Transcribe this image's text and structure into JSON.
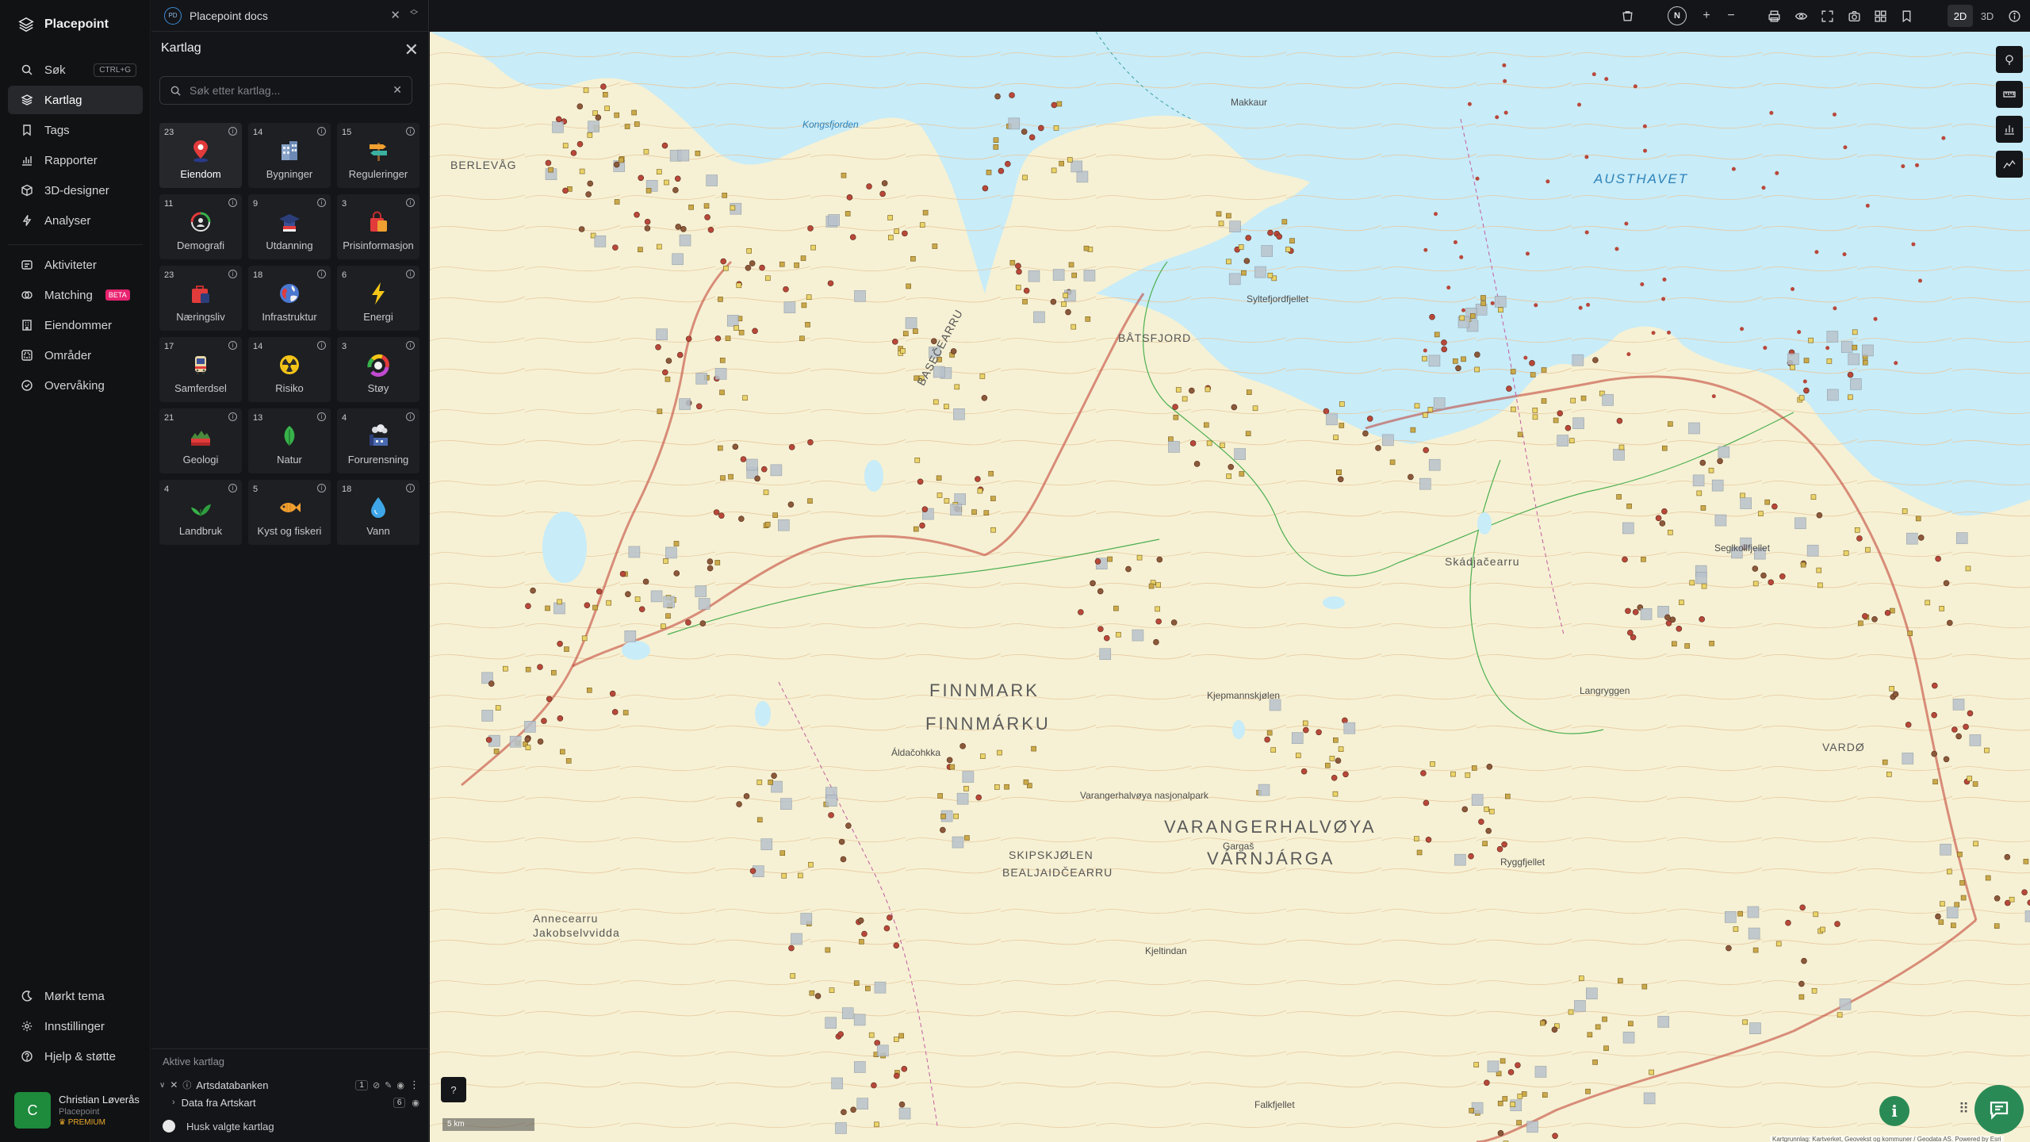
{
  "app": {
    "name": "Placepoint"
  },
  "nav": {
    "search": {
      "label": "Søk",
      "shortcut": "CTRL+G"
    },
    "items": [
      {
        "label": "Kartlag",
        "icon": "layers-icon",
        "active": true
      },
      {
        "label": "Tags",
        "icon": "bookmark-icon"
      },
      {
        "label": "Rapporter",
        "icon": "bar-chart-icon"
      },
      {
        "label": "3D-designer",
        "icon": "cube-icon"
      },
      {
        "label": "Analyser",
        "icon": "bolt-icon"
      }
    ],
    "items2": [
      {
        "label": "Aktiviteter",
        "icon": "activity-icon"
      },
      {
        "label": "Matching",
        "icon": "matching-icon",
        "badge": "BETA"
      },
      {
        "label": "Eiendommer",
        "icon": "building-icon"
      },
      {
        "label": "Områder",
        "icon": "area-icon"
      },
      {
        "label": "Overvåking",
        "icon": "monitor-icon"
      }
    ],
    "bottom": [
      {
        "label": "Mørkt tema",
        "icon": "moon-icon"
      },
      {
        "label": "Innstillinger",
        "icon": "gear-icon"
      },
      {
        "label": "Hjelp & støtte",
        "icon": "help-icon"
      }
    ]
  },
  "user": {
    "initial": "C",
    "name": "Christian Løverås",
    "org": "Placepoint",
    "plan": "PREMIUM"
  },
  "doc": {
    "badge": "PD",
    "title": "Placepoint docs"
  },
  "panel": {
    "title": "Kartlag",
    "search_placeholder": "Søk etter kartlag...",
    "categories": [
      {
        "count": "23",
        "label": "Eiendom",
        "icon": "property-pin-icon",
        "selected": true
      },
      {
        "count": "14",
        "label": "Bygninger",
        "icon": "buildings-icon"
      },
      {
        "count": "15",
        "label": "Reguleringer",
        "icon": "regulation-sign-icon"
      },
      {
        "count": "11",
        "label": "Demografi",
        "icon": "demography-icon"
      },
      {
        "count": "9",
        "label": "Utdanning",
        "icon": "graduation-cap-icon"
      },
      {
        "count": "3",
        "label": "Prisinformasjon",
        "icon": "shopping-bag-icon"
      },
      {
        "count": "23",
        "label": "Næringsliv",
        "icon": "briefcase-icon"
      },
      {
        "count": "18",
        "label": "Infrastruktur",
        "icon": "globe-icon"
      },
      {
        "count": "6",
        "label": "Energi",
        "icon": "lightning-icon"
      },
      {
        "count": "17",
        "label": "Samferdsel",
        "icon": "bus-icon"
      },
      {
        "count": "14",
        "label": "Risiko",
        "icon": "hazard-icon"
      },
      {
        "count": "3",
        "label": "Støy",
        "icon": "noise-gauge-icon"
      },
      {
        "count": "21",
        "label": "Geologi",
        "icon": "geology-icon"
      },
      {
        "count": "13",
        "label": "Natur",
        "icon": "leaf-icon"
      },
      {
        "count": "4",
        "label": "Forurensning",
        "icon": "factory-icon"
      },
      {
        "count": "4",
        "label": "Landbruk",
        "icon": "plant-icon"
      },
      {
        "count": "5",
        "label": "Kyst og fiskeri",
        "icon": "fish-icon"
      },
      {
        "count": "18",
        "label": "Vann",
        "icon": "water-drop-icon"
      }
    ],
    "active_title": "Aktive kartlag",
    "active_layer": {
      "name": "Artsdatabanken",
      "count": "1",
      "sub": "Data fra Artskart",
      "sub_count": "6"
    },
    "remember_label": "Husk valgte kartlag"
  },
  "toolbar": {
    "north": "N",
    "mode_2d": "2D",
    "mode_3d": "3D"
  },
  "map": {
    "labels": {
      "finnmark": "FINNMARK",
      "finnmarku": "FINNMÁRKU",
      "varanger": "VARANGERHALVØYA",
      "varnjarga": "VÁRNJÁRGA",
      "austhavet": "AUSTHAVET",
      "kongsfjorden": "Kongsfjorden",
      "batsfjord": "BÅTSFJORD",
      "basecearru": "BASEČEARRU",
      "berlevag": "BERLEVÅG",
      "skipskjolen": "SKIPSKJØLEN",
      "bealjaid": "BEALJAIDČEARRU",
      "annecearru": "Annecearru",
      "jakob": "Jakobselvvidda",
      "skadja": "Skádjačearru",
      "nasjonalpark": "Varangerhalvøya nasjonalpark",
      "vardo": "VARDØ",
      "syltefjord": "Syltefjordfjellet",
      "kjepmann": "Kjepmannskjølen",
      "langryggen": "Langryggen",
      "makkaur": "Makkaur",
      "ryggfjellet": "Ryggfjellet",
      "gargas": "Gargaš",
      "aldacohkka": "Áldačohkka",
      "seglkollfjellet": "Seglkollfjellet",
      "kjeltindan": "Kjeltindan",
      "falkfjellet": "Falkfjellet"
    },
    "scale": "5 km",
    "attribution": "Kartgrunnlag: Kartverket, Geovekst og kommuner / Geodata AS. Powered by Esri"
  }
}
